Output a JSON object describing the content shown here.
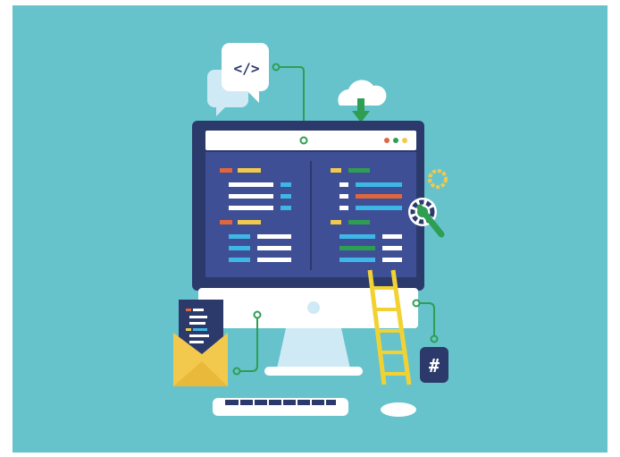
{
  "illustration": {
    "code_bubble_text": "</>",
    "badge_text": "#"
  },
  "colors": {
    "background": "#66c3cc",
    "monitor_frame": "#2b3a6b",
    "screen_bg": "#3e4f96",
    "browser_bar": "#ffffff",
    "accent_green": "#2e9e53",
    "accent_yellow": "#f2c94c",
    "accent_orange": "#e0663b",
    "accent_blue": "#3fb7e6",
    "ladder": "#f2d233",
    "envelope": "#f2c94c",
    "light_blue": "#cfeaf5"
  }
}
